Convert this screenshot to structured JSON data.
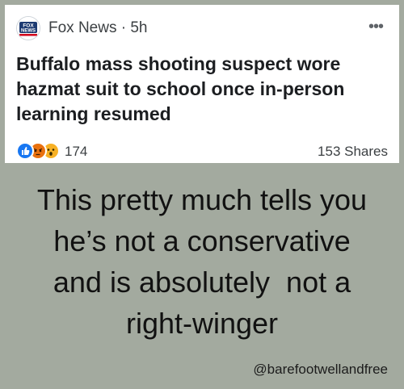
{
  "post": {
    "source": "Fox News",
    "separator": "·",
    "age": "5h",
    "more_icon": "ellipsis-icon",
    "logo_text": [
      "FOX",
      "NEWS"
    ],
    "headline": "Buffalo mass shooting suspect wore hazmat suit to school once in-person learning resumed",
    "reactions": [
      "like-icon",
      "angry-icon",
      "wow-icon"
    ],
    "reaction_count": "174",
    "shares": "153 Shares"
  },
  "caption": {
    "lines": [
      "This pretty much tells you",
      "he’s not a conservative",
      "and is absolutely  not a",
      "right-winger"
    ]
  },
  "watermark": "@barefootwellandfree",
  "colors": {
    "background": "#a3aa9f",
    "card": "#ffffff",
    "like_blue": "#1877f2",
    "angry_orange": "#e9710f",
    "wow_yellow": "#f7b125",
    "fox_navy": "#1d3b72",
    "fox_red": "#d0021b"
  }
}
